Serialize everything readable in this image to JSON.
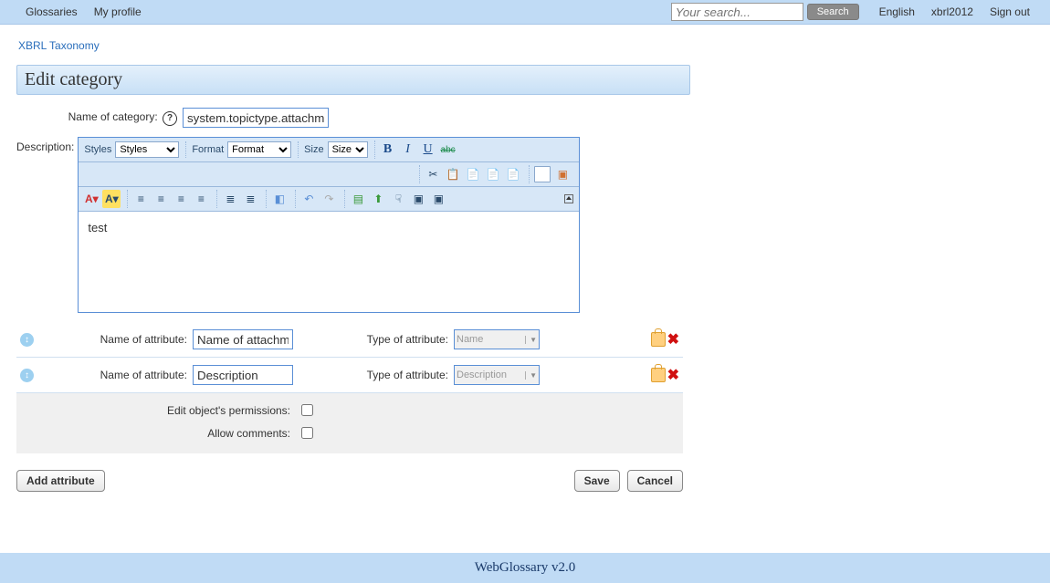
{
  "topnav": {
    "glossaries": "Glossaries",
    "profile": "My profile"
  },
  "search": {
    "placeholder": "Your search...",
    "button": "Search"
  },
  "toplinks": {
    "lang": "English",
    "user": "xbrl2012",
    "signout": "Sign out"
  },
  "breadcrumb": "XBRL Taxonomy",
  "page_title": "Edit category",
  "labels": {
    "name_of_category": "Name of category:",
    "description": "Description:",
    "name_of_attribute": "Name of attribute:",
    "type_of_attribute": "Type of attribute:",
    "edit_permissions": "Edit object's permissions:",
    "allow_comments": "Allow comments:",
    "add_attribute": "Add attribute",
    "save": "Save",
    "cancel": "Cancel"
  },
  "category_name": "system.topictype.attachment",
  "editor": {
    "styles_label": "Styles",
    "styles_value": "Styles",
    "format_label": "Format",
    "format_value": "Format",
    "size_label": "Size",
    "size_value": "Size",
    "content": "test"
  },
  "attributes": [
    {
      "name": "Name of attachment",
      "type": "Name"
    },
    {
      "name": "Description",
      "type": "Description"
    }
  ],
  "permissions": {
    "edit": false,
    "comments": false
  },
  "footer": "WebGlossary v2.0"
}
